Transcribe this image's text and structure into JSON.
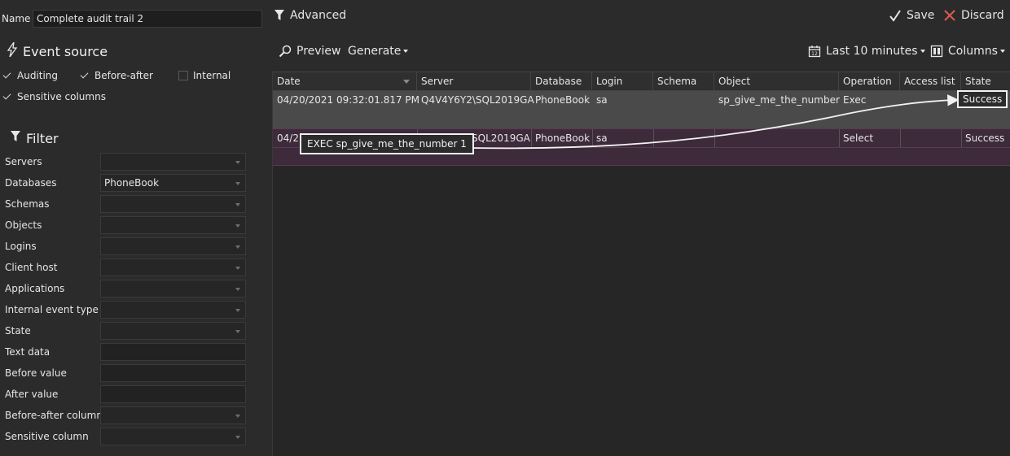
{
  "name": {
    "label": "Name",
    "value": "Complete audit trail 2"
  },
  "event_source": {
    "title": "Event source",
    "options": [
      {
        "label": "Auditing",
        "checked": true
      },
      {
        "label": "Before-after",
        "checked": true
      },
      {
        "label": "Internal",
        "checked": false
      },
      {
        "label": "Sensitive columns",
        "checked": true
      }
    ]
  },
  "filter": {
    "title": "Filter",
    "rows": [
      {
        "label": "Servers",
        "value": "",
        "kind": "combo"
      },
      {
        "label": "Databases",
        "value": "PhoneBook",
        "kind": "combo"
      },
      {
        "label": "Schemas",
        "value": "",
        "kind": "combo"
      },
      {
        "label": "Objects",
        "value": "",
        "kind": "combo"
      },
      {
        "label": "Logins",
        "value": "",
        "kind": "combo"
      },
      {
        "label": "Client host",
        "value": "",
        "kind": "combo"
      },
      {
        "label": "Applications",
        "value": "",
        "kind": "combo"
      },
      {
        "label": "Internal event type",
        "value": "",
        "kind": "combo"
      },
      {
        "label": "State",
        "value": "",
        "kind": "combo"
      },
      {
        "label": "Text data",
        "value": "",
        "kind": "text"
      },
      {
        "label": "Before value",
        "value": "",
        "kind": "text"
      },
      {
        "label": "After value",
        "value": "",
        "kind": "text"
      },
      {
        "label": "Before-after column",
        "value": "",
        "kind": "combo"
      },
      {
        "label": "Sensitive column",
        "value": "",
        "kind": "combo"
      }
    ]
  },
  "toolbar": {
    "advanced": "Advanced",
    "save": "Save",
    "discard": "Discard",
    "preview": "Preview",
    "generate": "Generate",
    "time_range": "Last 10 minutes",
    "columns": "Columns"
  },
  "grid": {
    "columns": [
      "Date",
      "Server",
      "Database",
      "Login",
      "Schema",
      "Object",
      "Operation",
      "Access list",
      "State"
    ],
    "rows": [
      {
        "date": "04/20/2021 09:32:01.817 PM",
        "server": "Q4V4Y6Y2\\SQL2019GA",
        "database": "PhoneBook",
        "login": "sa",
        "schema": "",
        "object": "sp_give_me_the_number",
        "operation": "Exec",
        "access_list": "",
        "state": "Success"
      },
      {
        "date": "04/2",
        "server": "\\SQL2019GA",
        "database": "PhoneBook",
        "login": "sa",
        "schema": "",
        "object": "",
        "operation": "Select",
        "access_list": "",
        "state": "Success"
      }
    ]
  },
  "callout": {
    "text": "EXEC sp_give_me_the_number 1"
  }
}
